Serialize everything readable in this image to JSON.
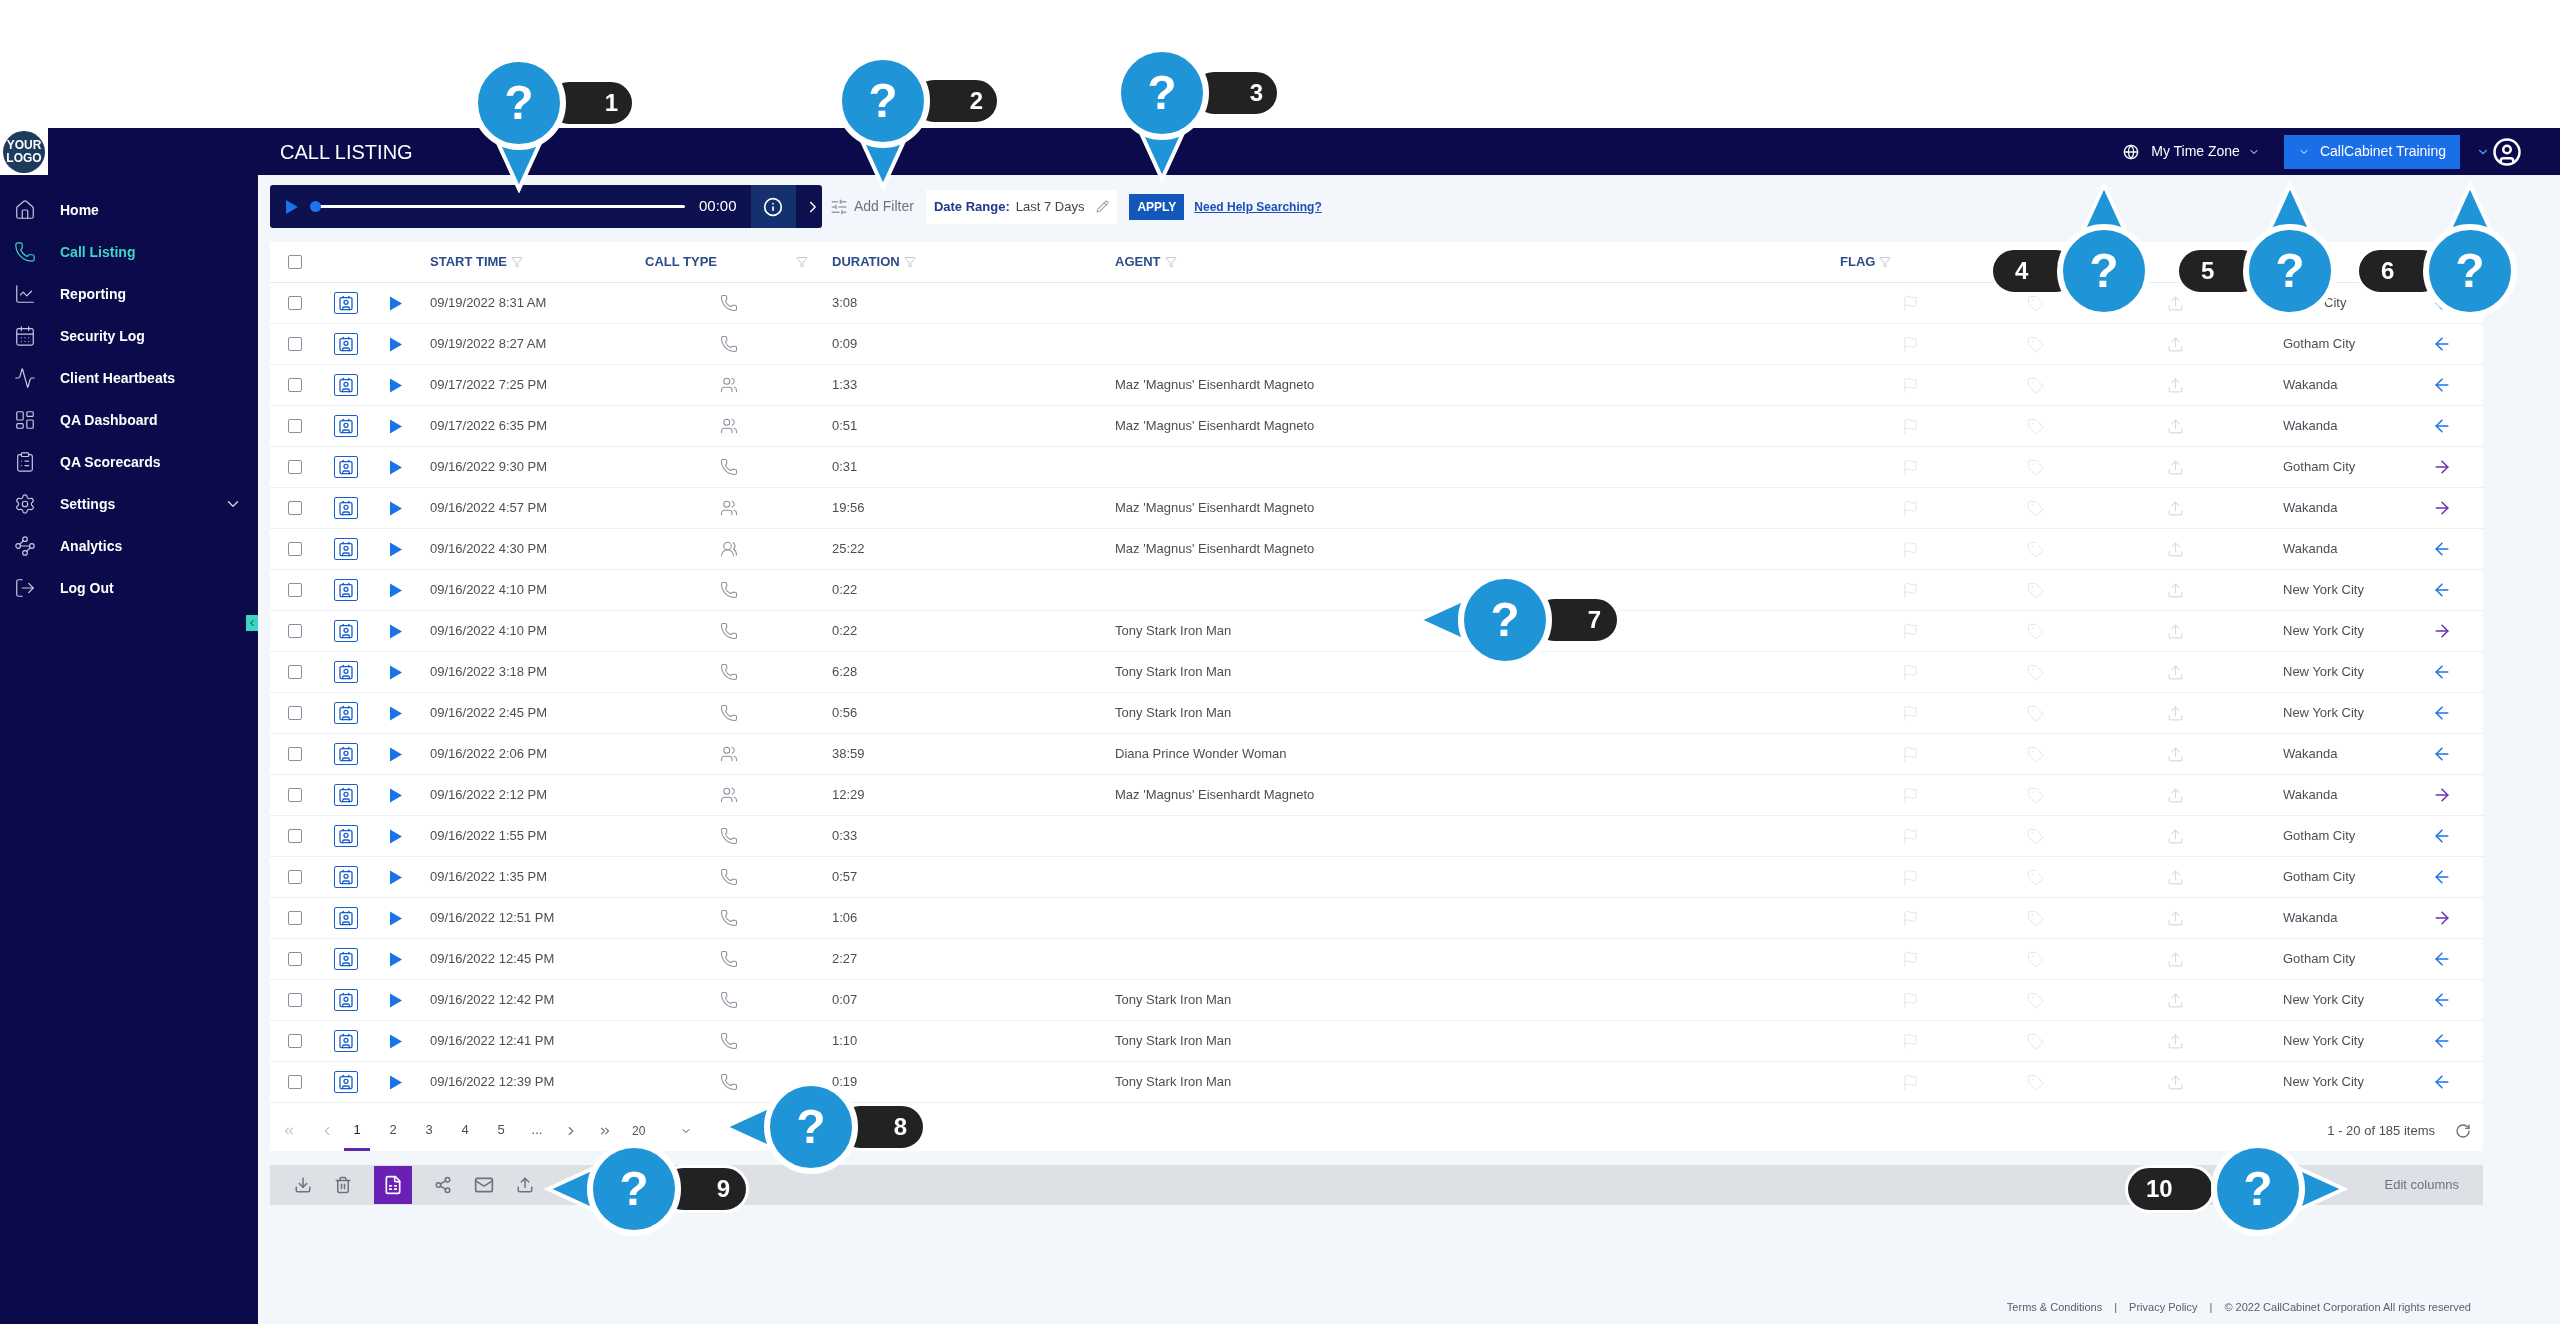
{
  "logo": {
    "lines": [
      "YOUR",
      "LOGO"
    ]
  },
  "header": {
    "title": "CALL LISTING",
    "time_zone": "My Time Zone",
    "account": "CallCabinet Training"
  },
  "sidebar": {
    "items": [
      {
        "label": "Home",
        "selected": false
      },
      {
        "label": "Call Listing",
        "selected": true
      },
      {
        "label": "Reporting",
        "selected": false
      },
      {
        "label": "Security Log",
        "selected": false
      },
      {
        "label": "Client Heartbeats",
        "selected": false
      },
      {
        "label": "QA Dashboard",
        "selected": false
      },
      {
        "label": "QA Scorecards",
        "selected": false
      },
      {
        "label": "Settings",
        "selected": false,
        "expanded": false
      },
      {
        "label": "Analytics",
        "selected": false
      },
      {
        "label": "Log Out",
        "selected": false
      }
    ]
  },
  "player": {
    "level": 0,
    "time": "00:00"
  },
  "filters": {
    "add_filter": "Add Filter",
    "date_label": "Date Range:",
    "date_value": "Last 7 Days",
    "apply": "APPLY",
    "help_link": "Need Help Searching?"
  },
  "table": {
    "select_all_checked": false,
    "columns": {
      "start_time": "START TIME",
      "call_type": "CALL TYPE",
      "duration": "DURATION",
      "agent": "AGENT",
      "flag": "FLAG"
    },
    "rows": [
      {
        "checked": false,
        "start_time": "09/19/2022 8:31 AM",
        "call_type": {
          "kind": "phone"
        },
        "duration": "3:08",
        "location": "City",
        "direction": {
          "kind": "in"
        }
      },
      {
        "checked": false,
        "start_time": "09/19/2022 8:27 AM",
        "call_type": {
          "kind": "phone"
        },
        "duration": "0:09",
        "location": "Gotham City",
        "direction": {
          "kind": "in"
        }
      },
      {
        "checked": false,
        "start_time": "09/17/2022 7:25 PM",
        "call_type": {
          "kind": "internal"
        },
        "duration": "1:33",
        "agent": "Maz 'Magnus' Eisenhardt Magneto",
        "location": "Wakanda",
        "direction": {
          "kind": "in"
        }
      },
      {
        "checked": false,
        "start_time": "09/17/2022 6:35 PM",
        "call_type": {
          "kind": "internal"
        },
        "duration": "0:51",
        "agent": "Maz 'Magnus' Eisenhardt Magneto",
        "location": "Wakanda",
        "direction": {
          "kind": "in"
        }
      },
      {
        "checked": false,
        "start_time": "09/16/2022 9:30 PM",
        "call_type": {
          "kind": "phone"
        },
        "duration": "0:31",
        "location": "Gotham City",
        "direction": {
          "kind": "out"
        }
      },
      {
        "checked": false,
        "start_time": "09/16/2022 4:57 PM",
        "call_type": {
          "kind": "internal"
        },
        "duration": "19:56",
        "agent": "Maz 'Magnus' Eisenhardt Magneto",
        "location": "Wakanda",
        "direction": {
          "kind": "out"
        }
      },
      {
        "checked": false,
        "start_time": "09/16/2022 4:30 PM",
        "call_type": {
          "kind": "conference"
        },
        "duration": "25:22",
        "agent": "Maz 'Magnus' Eisenhardt Magneto",
        "location": "Wakanda",
        "direction": {
          "kind": "in"
        }
      },
      {
        "checked": false,
        "start_time": "09/16/2022 4:10 PM",
        "call_type": {
          "kind": "phone"
        },
        "duration": "0:22",
        "location": "New York City",
        "direction": {
          "kind": "in"
        }
      },
      {
        "checked": false,
        "start_time": "09/16/2022 4:10 PM",
        "call_type": {
          "kind": "phone"
        },
        "duration": "0:22",
        "agent": "Tony Stark Iron Man",
        "location": "New York City",
        "direction": {
          "kind": "out"
        }
      },
      {
        "checked": false,
        "start_time": "09/16/2022 3:18 PM",
        "call_type": {
          "kind": "phone"
        },
        "duration": "6:28",
        "agent": "Tony Stark Iron Man",
        "location": "New York City",
        "direction": {
          "kind": "in"
        }
      },
      {
        "checked": false,
        "start_time": "09/16/2022 2:45 PM",
        "call_type": {
          "kind": "phone"
        },
        "duration": "0:56",
        "agent": "Tony Stark Iron Man",
        "location": "New York City",
        "direction": {
          "kind": "in"
        }
      },
      {
        "checked": false,
        "start_time": "09/16/2022 2:06 PM",
        "call_type": {
          "kind": "internal"
        },
        "duration": "38:59",
        "agent": "Diana Prince Wonder Woman",
        "location": "Wakanda",
        "direction": {
          "kind": "in"
        }
      },
      {
        "checked": false,
        "start_time": "09/16/2022 2:12 PM",
        "call_type": {
          "kind": "internal"
        },
        "duration": "12:29",
        "agent": "Maz 'Magnus' Eisenhardt Magneto",
        "location": "Wakanda",
        "direction": {
          "kind": "out"
        }
      },
      {
        "checked": false,
        "start_time": "09/16/2022 1:55 PM",
        "call_type": {
          "kind": "phone"
        },
        "duration": "0:33",
        "location": "Gotham City",
        "direction": {
          "kind": "in"
        }
      },
      {
        "checked": false,
        "start_time": "09/16/2022 1:35 PM",
        "call_type": {
          "kind": "phone"
        },
        "duration": "0:57",
        "location": "Gotham City",
        "direction": {
          "kind": "in"
        }
      },
      {
        "checked": false,
        "start_time": "09/16/2022 12:51 PM",
        "call_type": {
          "kind": "phone"
        },
        "duration": "1:06",
        "location": "Wakanda",
        "direction": {
          "kind": "out"
        }
      },
      {
        "checked": false,
        "start_time": "09/16/2022 12:45 PM",
        "call_type": {
          "kind": "phone"
        },
        "duration": "2:27",
        "location": "Gotham City",
        "direction": {
          "kind": "in"
        }
      },
      {
        "checked": false,
        "start_time": "09/16/2022 12:42 PM",
        "call_type": {
          "kind": "phone"
        },
        "duration": "0:07",
        "agent": "Tony Stark Iron Man",
        "location": "New York City",
        "direction": {
          "kind": "in"
        }
      },
      {
        "checked": false,
        "start_time": "09/16/2022 12:41 PM",
        "call_type": {
          "kind": "phone"
        },
        "duration": "1:10",
        "agent": "Tony Stark Iron Man",
        "location": "New York City",
        "direction": {
          "kind": "in"
        }
      },
      {
        "checked": false,
        "start_time": "09/16/2022 12:39 PM",
        "call_type": {
          "kind": "phone"
        },
        "duration": "0:19",
        "agent": "Tony Stark Iron Man",
        "location": "New York City",
        "direction": {
          "kind": "in"
        }
      }
    ]
  },
  "pagination": {
    "pages": [
      {
        "label": "1",
        "selected": true
      },
      {
        "label": "2",
        "selected": false
      },
      {
        "label": "3",
        "selected": false
      },
      {
        "label": "4",
        "selected": false
      },
      {
        "label": "5",
        "selected": false
      },
      {
        "label": "...",
        "selected": false
      }
    ],
    "page_size": "20",
    "summary": "1 - 20 of 185 items"
  },
  "toolbar": {
    "edit_columns": "Edit columns"
  },
  "footer": {
    "links": [
      "Terms & Conditions",
      "Privacy Policy"
    ],
    "copyright": "© 2022 CallCabinet Corporation All rights reserved",
    "separator": "|"
  },
  "callouts": [
    {
      "number": "1",
      "mark": "?",
      "kind": "down"
    },
    {
      "number": "2",
      "mark": "?",
      "kind": "down"
    },
    {
      "number": "3",
      "mark": "?",
      "kind": "down"
    },
    {
      "number": "4",
      "mark": "?",
      "kind": "up"
    },
    {
      "number": "5",
      "mark": "?",
      "kind": "up"
    },
    {
      "number": "6",
      "mark": "?",
      "kind": "up"
    },
    {
      "number": "7",
      "mark": "?",
      "kind": "left"
    },
    {
      "number": "8",
      "mark": "?",
      "kind": "left"
    },
    {
      "number": "9",
      "mark": "?",
      "kind": "left"
    },
    {
      "number": "10",
      "mark": "?",
      "kind": "right"
    }
  ]
}
